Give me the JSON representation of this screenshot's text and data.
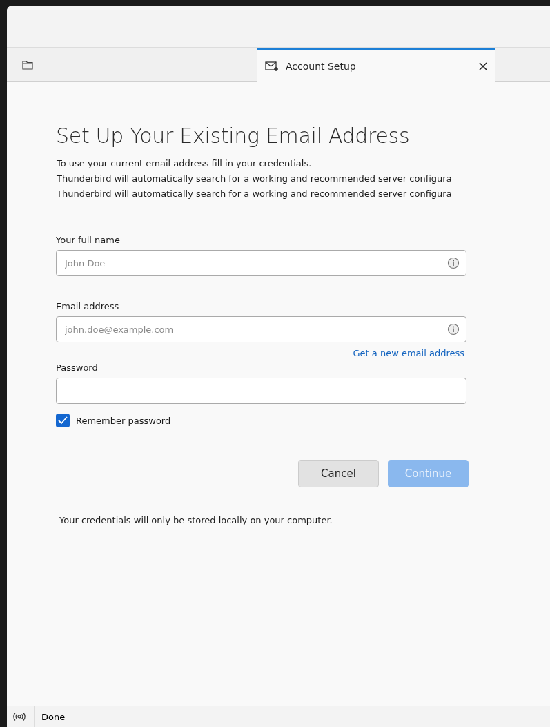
{
  "tabs": [
    {
      "label": "Account Setup",
      "selected": true
    }
  ],
  "heading": "Set Up Your Existing Email Address",
  "intro": [
    "To use your current email address fill in your credentials.",
    "Thunderbird will automatically search for a working and recommended server configura",
    "Thunderbird will automatically search for a working and recommended server configura"
  ],
  "fields": [
    {
      "label": "Your full name",
      "placeholder": "John Doe",
      "info": true
    },
    {
      "label": "Email address",
      "placeholder": "john.doe@example.com",
      "info": true,
      "link": "Get a new email address"
    },
    {
      "label": "Password",
      "info": false
    }
  ],
  "remember": {
    "label": "Remember password",
    "checked": true
  },
  "buttons": [
    {
      "label": "Cancel",
      "disabled": false,
      "kind": "secondary"
    },
    {
      "label": "Continue",
      "disabled": true,
      "kind": "primary"
    }
  ],
  "note": "Your credentials will only be stored locally on your computer.",
  "status_bar": {
    "text": "Done"
  }
}
